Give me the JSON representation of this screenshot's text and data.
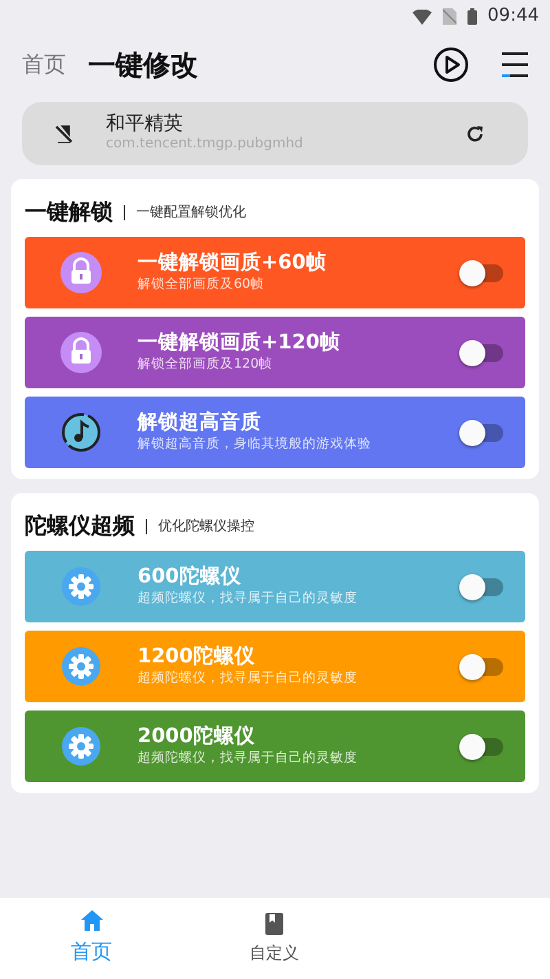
{
  "status_bar": {
    "time": "09:44"
  },
  "header": {
    "back_label": "首页",
    "title": "一键修改"
  },
  "game": {
    "name": "和平精英",
    "package": "com.tencent.tmgp.pubgmhd"
  },
  "sections": [
    {
      "title": "一键解锁",
      "subtitle": "一键配置解锁优化",
      "items": [
        {
          "kind": "lock",
          "title": "一键解锁画质+60帧",
          "description": "解锁全部画质及60帧",
          "color": "#ff5722",
          "on": false
        },
        {
          "kind": "lock",
          "title": "一键解锁画质+120帧",
          "description": "解锁全部画质及120帧",
          "color": "#9c4dbd",
          "on": false
        },
        {
          "kind": "music",
          "title": "解锁超高音质",
          "description": "解锁超高音质，身临其境般的游戏体验",
          "color": "#6176f0",
          "on": false
        }
      ]
    },
    {
      "title": "陀螺仪超频",
      "subtitle": "优化陀螺仪操控",
      "items": [
        {
          "kind": "gear",
          "title": "600陀螺仪",
          "description": "超频陀螺仪，找寻属于自己的灵敏度",
          "color": "#5cb6d4",
          "on": false
        },
        {
          "kind": "gear",
          "title": "1200陀螺仪",
          "description": "超频陀螺仪，找寻属于自己的灵敏度",
          "color": "#ff9a00",
          "on": false
        },
        {
          "kind": "gear",
          "title": "2000陀螺仪",
          "description": "超频陀螺仪，找寻属于自己的灵敏度",
          "color": "#4f9630",
          "on": false
        }
      ]
    }
  ],
  "bottom_nav": [
    {
      "label": "首页",
      "kind": "home",
      "selected": true
    },
    {
      "label": "自定义",
      "kind": "book",
      "selected": false
    }
  ]
}
